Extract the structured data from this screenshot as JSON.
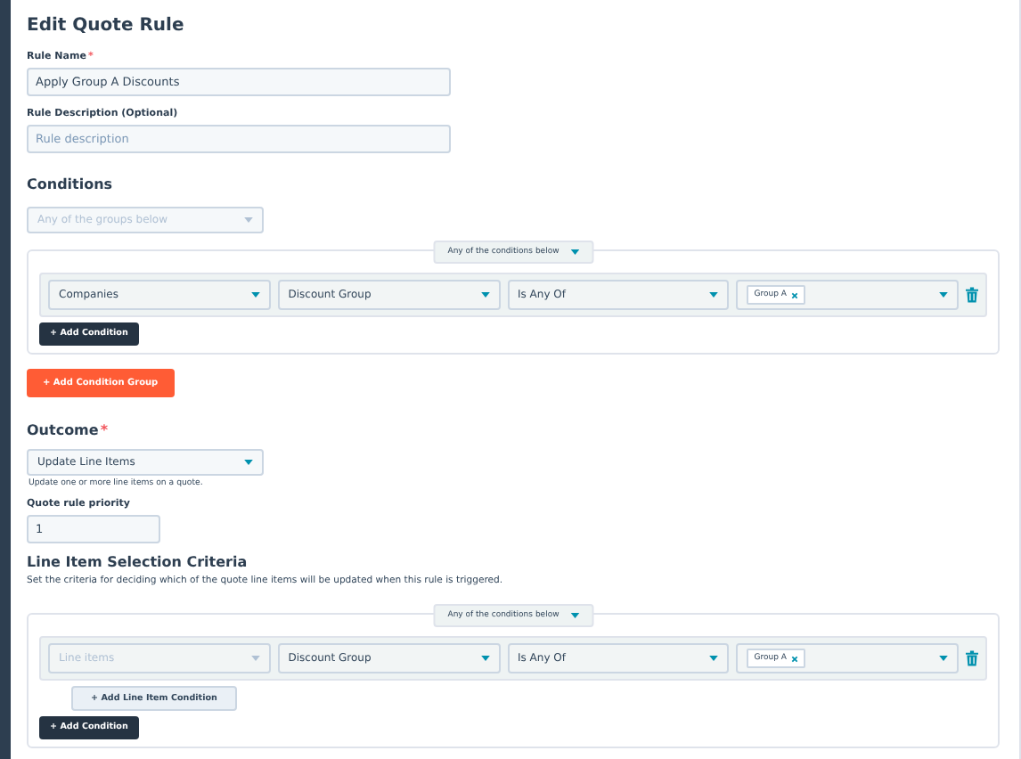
{
  "title": "Edit Quote Rule",
  "rule_name": {
    "label": "Rule Name",
    "required": true,
    "required_mark": "*",
    "value": "Apply Group A Discounts"
  },
  "rule_description": {
    "label": "Rule Description (Optional)",
    "placeholder": "Rule description"
  },
  "conditions": {
    "heading": "Conditions",
    "group_mode": {
      "value": "Any of the groups below",
      "disabled": true
    },
    "group": {
      "mode": "Any of the conditions below",
      "rows": [
        {
          "object": {
            "value": "Companies",
            "disabled": false
          },
          "property": {
            "value": "Discount Group",
            "disabled": false
          },
          "operator": {
            "value": "Is Any Of",
            "disabled": false
          },
          "values": [
            "Group A"
          ]
        }
      ],
      "add_condition": "+ Add Condition"
    },
    "add_group": "+ Add Condition Group"
  },
  "outcome": {
    "heading": "Outcome",
    "required": true,
    "required_mark": "*",
    "select": "Update Line Items",
    "help": "Update one or more line items on a quote."
  },
  "priority": {
    "label": "Quote rule priority",
    "value": "1"
  },
  "line_items": {
    "heading": "Line Item Selection Criteria",
    "description": "Set the criteria for deciding which of the quote line items will be updated when this rule is triggered.",
    "group": {
      "mode": "Any of the conditions below",
      "rows": [
        {
          "object": {
            "value": "Line items",
            "disabled": true
          },
          "property": {
            "value": "Discount Group",
            "disabled": false
          },
          "operator": {
            "value": "Is Any Of",
            "disabled": false
          },
          "values": [
            "Group A"
          ]
        }
      ],
      "add_line_item_condition": "+ Add Line Item Condition",
      "add_condition": "+ Add Condition"
    }
  }
}
